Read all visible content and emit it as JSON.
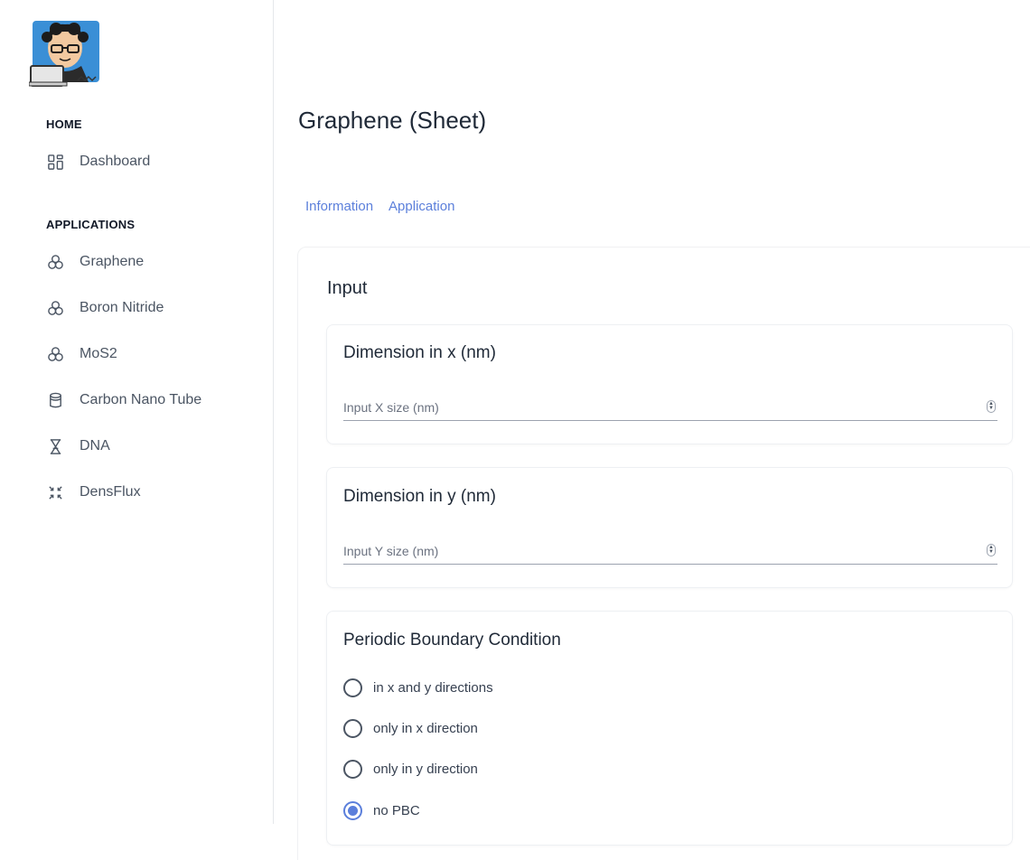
{
  "sidebar": {
    "sections": [
      {
        "heading": "HOME",
        "items": [
          {
            "label": "Dashboard",
            "icon": "dashboard-icon"
          }
        ]
      },
      {
        "heading": "APPLICATIONS",
        "items": [
          {
            "label": "Graphene",
            "icon": "molecule-icon"
          },
          {
            "label": "Boron Nitride",
            "icon": "molecule-icon"
          },
          {
            "label": "MoS2",
            "icon": "molecule-icon"
          },
          {
            "label": "Carbon Nano Tube",
            "icon": "cylinder-icon"
          },
          {
            "label": "DNA",
            "icon": "hourglass-icon"
          },
          {
            "label": "DensFlux",
            "icon": "arrows-shrink-icon"
          }
        ]
      }
    ]
  },
  "main": {
    "title": "Graphene (Sheet)",
    "tabs": [
      {
        "label": "Information"
      },
      {
        "label": "Application"
      }
    ],
    "input_section": {
      "title": "Input",
      "dimension_x": {
        "title": "Dimension in x (nm)",
        "placeholder": "Input X size (nm)",
        "value": ""
      },
      "dimension_y": {
        "title": "Dimension in y (nm)",
        "placeholder": "Input Y size (nm)",
        "value": ""
      },
      "pbc": {
        "title": "Periodic Boundary Condition",
        "options": [
          {
            "label": "in x and y directions",
            "checked": false
          },
          {
            "label": "only in x direction",
            "checked": false
          },
          {
            "label": "only in y direction",
            "checked": false
          },
          {
            "label": "no PBC",
            "checked": true
          }
        ]
      }
    }
  },
  "colors": {
    "accent": "#5b7fdb",
    "text": "#1f2937",
    "muted": "#4b5563"
  }
}
